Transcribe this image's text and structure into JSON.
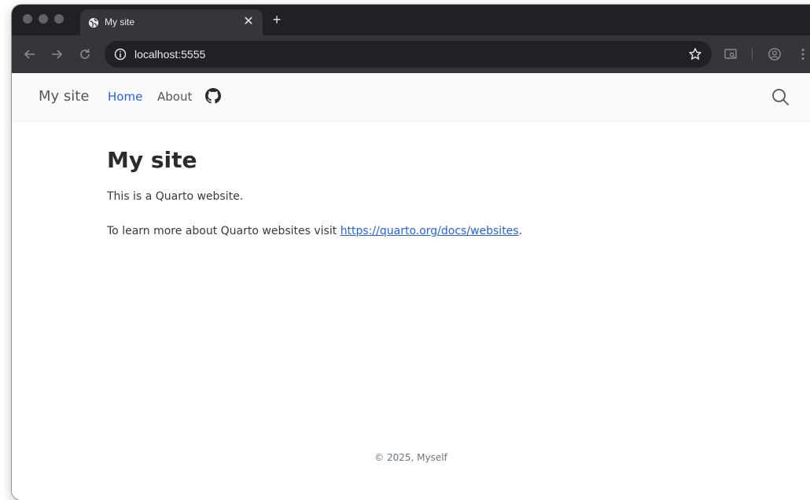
{
  "browser": {
    "tab": {
      "title": "My site",
      "close_glyph": "✕"
    },
    "new_tab_glyph": "+",
    "address_bar": {
      "url": "localhost:5555"
    }
  },
  "site": {
    "navbar": {
      "brand": "My site",
      "links": [
        {
          "label": "Home",
          "active": true
        },
        {
          "label": "About",
          "active": false
        }
      ],
      "icons": [
        "github-icon",
        "search-icon"
      ]
    },
    "content": {
      "title": "My site",
      "paragraph1": "This is a Quarto website.",
      "paragraph2_prefix": "To learn more about Quarto websites visit ",
      "link_text": "https://quarto.org/docs/websites",
      "paragraph2_suffix": "."
    },
    "footer": "© 2025, Myself"
  },
  "colors": {
    "tabstrip": "#202124",
    "toolbar": "#35363a",
    "navbar_bg": "#f8f9fb",
    "link_active": "#2761e3",
    "heading": "#2b2b2b"
  }
}
